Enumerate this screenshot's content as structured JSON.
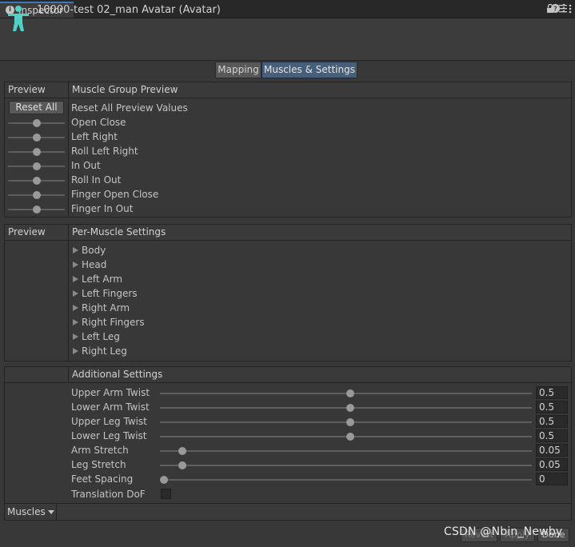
{
  "window": {
    "tab_label": "Inspector",
    "tab_icon": "info-icon",
    "lock_icon": "lock-icon",
    "menu_icon": "kebab-menu-icon"
  },
  "header": {
    "title": "10000-test 02_man Avatar (Avatar)",
    "avatar_icon": "humanoid-avatar-icon",
    "avatar_color": "#4fd1c5",
    "help_icon": "help-icon",
    "settings_icon": "settings-sliders-icon",
    "menu_icon": "kebab-menu-icon"
  },
  "mode_tabs": {
    "mapping_label": "Mapping",
    "muscles_label": "Muscles & Settings",
    "active": "Muscles & Settings"
  },
  "muscle_group_preview": {
    "col_preview": "Preview",
    "col_title": "Muscle Group Preview",
    "reset_button_label": "Reset All",
    "reset_row_label": "Reset All Preview Values",
    "sliders": [
      {
        "label": "Open Close",
        "value": 0.5
      },
      {
        "label": "Left Right",
        "value": 0.5
      },
      {
        "label": "Roll Left Right",
        "value": 0.5
      },
      {
        "label": "In Out",
        "value": 0.5
      },
      {
        "label": "Roll In Out",
        "value": 0.5
      },
      {
        "label": "Finger Open Close",
        "value": 0.5
      },
      {
        "label": "Finger In Out",
        "value": 0.5
      }
    ]
  },
  "per_muscle_settings": {
    "col_preview": "Preview",
    "col_title": "Per-Muscle Settings",
    "groups": [
      "Body",
      "Head",
      "Left Arm",
      "Left Fingers",
      "Right Arm",
      "Right Fingers",
      "Left Leg",
      "Right Leg"
    ]
  },
  "additional_settings": {
    "title": "Additional Settings",
    "rows": [
      {
        "label": "Upper Arm Twist",
        "value": "0.5",
        "fraction": 0.5
      },
      {
        "label": "Lower Arm Twist",
        "value": "0.5",
        "fraction": 0.5
      },
      {
        "label": "Upper Leg Twist",
        "value": "0.5",
        "fraction": 0.5
      },
      {
        "label": "Lower Leg Twist",
        "value": "0.5",
        "fraction": 0.5
      },
      {
        "label": "Arm Stretch",
        "value": "0.05",
        "fraction": 0.05
      },
      {
        "label": "Leg Stretch",
        "value": "0.05",
        "fraction": 0.05
      },
      {
        "label": "Feet Spacing",
        "value": "0",
        "fraction": 0.0
      }
    ],
    "translation_dof_label": "Translation DoF",
    "translation_dof_checked": false
  },
  "footer": {
    "dropdown_label": "Muscles",
    "revert_label": "Revert",
    "apply_label": "Apply",
    "done_label": "Done"
  },
  "watermark": "CSDN @Nbin_Newby"
}
